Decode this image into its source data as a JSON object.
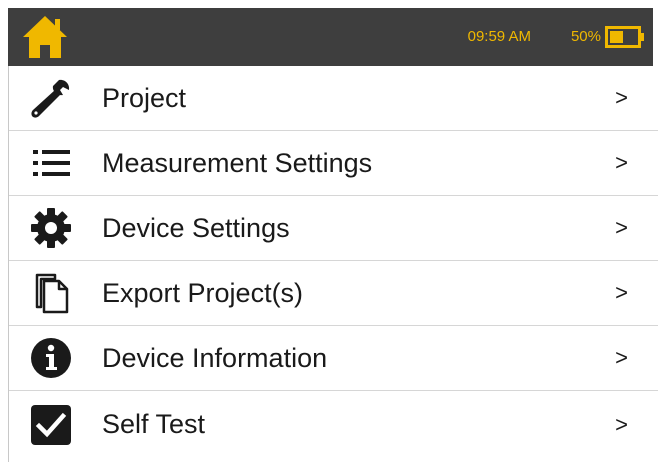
{
  "status_bar": {
    "time": "09:59 AM",
    "battery_percent": "50%",
    "battery_level": 0.5,
    "accent_color": "#f0b800",
    "background_color": "#3e3e3e",
    "home_icon": "home-icon",
    "battery_icon": "battery-icon"
  },
  "menu": {
    "chevron": ">",
    "items": [
      {
        "label": "Project",
        "icon": "wrench-icon"
      },
      {
        "label": "Measurement Settings",
        "icon": "list-icon"
      },
      {
        "label": "Device Settings",
        "icon": "gear-icon"
      },
      {
        "label": "Export Project(s)",
        "icon": "copy-document-icon"
      },
      {
        "label": "Device Information",
        "icon": "info-icon"
      },
      {
        "label": "Self Test",
        "icon": "checkbox-checked-icon"
      }
    ]
  }
}
